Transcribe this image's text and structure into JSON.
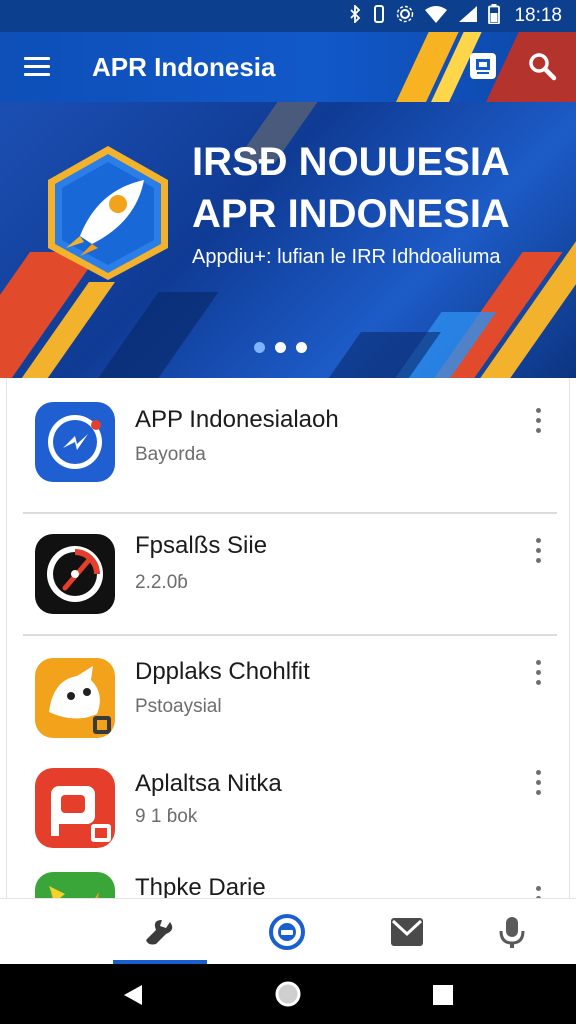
{
  "status_bar": {
    "time": "18:18",
    "icons": [
      "bluetooth-icon",
      "vibrate-icon",
      "settings-icon",
      "wifi-icon",
      "signal-icon",
      "battery-icon"
    ]
  },
  "app_bar": {
    "title": "APR Indonesia",
    "icons": [
      "menu-icon",
      "store-icon",
      "search-icon"
    ]
  },
  "banner": {
    "title_line_1": "IRSÐ NOUUESIA",
    "title_line_2": "APR INDONESIA",
    "subtitle": "Appdiu+: lufian le IRR Idhdoaliuma",
    "carousel_dots": 3,
    "active_dot": 1
  },
  "apps": [
    {
      "name": "APP Indonesialaoh",
      "meta": "Bayorda",
      "icon": "messenger-bolt-icon",
      "color": "#1f5fd1"
    },
    {
      "name": "Fpsalßs Siie",
      "meta": "2.2.0ɓ",
      "icon": "gauge-needle-icon",
      "color": "#111111"
    },
    {
      "name": "Dpplaks Chohlfit",
      "meta": "Pstoaysial",
      "icon": "ghost-cat-icon",
      "color": "#f3a21c"
    },
    {
      "name": "Aplaltsa Nitka",
      "meta": "9 1 ɓok",
      "icon": "red-play-icon",
      "color": "#e53f2c"
    },
    {
      "name": "Thpke Darie",
      "meta": "",
      "icon": "fox-character-icon",
      "color": "#3aa63a"
    }
  ],
  "bottom_nav": {
    "items": [
      "tools-icon",
      "chat-bubble-icon",
      "mail-icon",
      "microphone-icon"
    ],
    "active_index": 0,
    "accent": "#1a5fd0"
  },
  "system_nav": {
    "items": [
      "back-icon",
      "home-icon",
      "recents-icon"
    ]
  }
}
